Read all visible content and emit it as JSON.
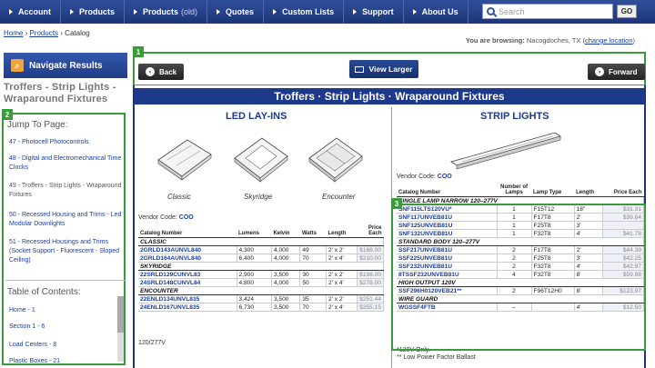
{
  "nav": {
    "items": [
      "Account",
      "Products",
      "Products",
      "Quotes",
      "Custom Lists",
      "Support",
      "About Us"
    ],
    "old_tag": "(old)"
  },
  "search": {
    "placeholder": "Search",
    "go": "GO"
  },
  "breadcrumb": {
    "home": "Home",
    "products": "Products",
    "current": "Catalog"
  },
  "browsing": {
    "label": "You are browsing:",
    "location": "Nacogdoches, TX",
    "change": "change location"
  },
  "sidebar": {
    "title": "Navigate Results",
    "category": "Troffers - Strip Lights - Wraparound Fixtures",
    "jump_title": "Jump To Page:",
    "jump_links": [
      "47 - Photocell Photocontrols",
      "48 - Digital and Electromechanical Time Clocks",
      "49 - Troffers - Strip Lights - Wraparound Fixtures",
      "50 - Recessed Housing and Trims - Led Modular Downlights",
      "51 - Recessed Housings and Trims (Socket Support - Fluorescent - Sloped Ceiling)"
    ],
    "toc_title": "Table of Contents:",
    "toc_links": [
      "Home - 1",
      "Section 1 - 6",
      "Load Centers - 8",
      "Plastic Boxes - 21"
    ]
  },
  "viewer": {
    "back": "Back",
    "view_larger": "View Larger",
    "forward": "Forward"
  },
  "annotations": [
    "1",
    "2",
    "3"
  ],
  "catalog": {
    "header": "Troffers · Strip Lights · Wraparound Fixtures",
    "led_title": "LED LAY-INS",
    "strip_title": "STRIP LIGHTS",
    "fixtures": [
      "Classic",
      "Skyridge",
      "Encounter"
    ],
    "vendor_label": "Vendor Code:",
    "vendor_code": "COO",
    "led_headers": [
      "Catalog Number",
      "Lumens",
      "Kelvin",
      "Watts",
      "Length",
      "Price Each"
    ],
    "led_groups": [
      {
        "name": "CLASSIC",
        "rows": [
          [
            "2GRLD143AUNVL840",
            "4,300",
            "4,000",
            "49",
            "2' x 2'",
            "$168.00"
          ],
          [
            "2GRLD164AUNVL840",
            "6,400",
            "4,000",
            "70",
            "2' x 4'",
            "$210.00"
          ]
        ]
      },
      {
        "name": "SKYRIDGE",
        "rows": [
          [
            "22SRLD129CUNVL83",
            "2,900",
            "3,500",
            "30",
            "2' x 2'",
            "$198.00"
          ],
          [
            "24SRLD148CUNVL84",
            "4,800",
            "4,000",
            "50",
            "2' x 4'",
            "$278.00"
          ]
        ]
      },
      {
        "name": "ENCOUNTER",
        "rows": [
          [
            "22ENLD134UNVL835",
            "3,424",
            "3,500",
            "35",
            "2' x 2'",
            "$251.44"
          ],
          [
            "24ENLD167UNVL835",
            "6,730",
            "3,500",
            "70",
            "2' x 4'",
            "$255.15"
          ]
        ]
      }
    ],
    "led_note": "120/277V",
    "strip_headers": [
      "Catalog Number",
      "Number of Lamps",
      "Lamp Type",
      "Length",
      "Price Each"
    ],
    "strip_groups": [
      {
        "name": "SINGLE LAMP NARROW 120–277V",
        "rows": [
          [
            "SNF115LTS120VU*",
            "1",
            "F15T12",
            "18\"",
            "$31.31"
          ],
          [
            "SNF117UNVEB81U",
            "1",
            "F17T8",
            "2'",
            "$39.64"
          ],
          [
            "SNF125UNVEB81U",
            "1",
            "F25T8",
            "3'",
            ""
          ],
          [
            "SNF132UNVEB81U",
            "1",
            "F32T8",
            "4'",
            "$41.78"
          ]
        ]
      },
      {
        "name": "STANDARD BODY 120–277V",
        "rows": [
          [
            "SSF217UNVEB81U",
            "2",
            "F17T8",
            "2'",
            "$44.39"
          ],
          [
            "SSF225UNVEB81U",
            "2",
            "F25T8",
            "3'",
            "$42.25"
          ],
          [
            "SSF232UNVEB81U",
            "2",
            "F32T8",
            "4'",
            "$42.97"
          ],
          [
            "8TSSF232UNVEB81U",
            "4",
            "F32T8",
            "8'",
            "$59.98"
          ]
        ]
      },
      {
        "name": "HIGH OUTPUT 120V",
        "rows": [
          [
            "SSF296H0120VEB21**",
            "2",
            "F96T12H0",
            "8'",
            "$123.97"
          ]
        ]
      },
      {
        "name": "WIRE GUARD",
        "rows": [
          [
            "WGSSF4FTB",
            "–",
            "",
            "4'",
            "$12.50"
          ]
        ]
      }
    ],
    "strip_notes": [
      "*120V Only.",
      "** Low Power Factor Ballast"
    ]
  },
  "colors": {
    "nav": "#1d3577",
    "accent_green": "#3a9b3a",
    "link": "#1b3f95"
  }
}
